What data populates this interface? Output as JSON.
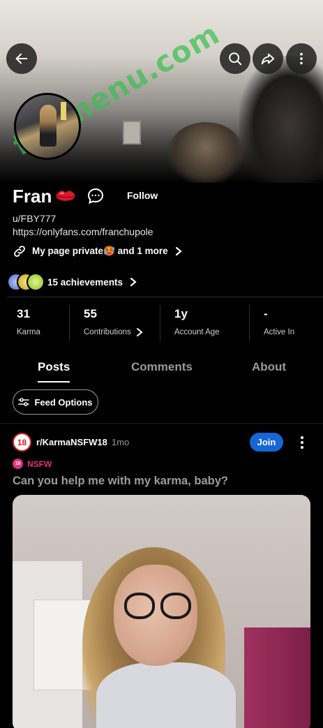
{
  "profile": {
    "display_name": "Fran",
    "username": "u/FBY777",
    "link": "https://onlyfans.com/franchupole",
    "follow_label": "Follow",
    "links_text": "My page private🥵 and 1 more",
    "achievements_text": "15 achievements"
  },
  "watermark": "fapmenu.com",
  "stats": [
    {
      "value": "31",
      "label": "Karma"
    },
    {
      "value": "55",
      "label": "Contributions"
    },
    {
      "value": "1y",
      "label": "Account Age"
    },
    {
      "value": "-",
      "label": "Active In"
    }
  ],
  "tabs": [
    {
      "label": "Posts",
      "active": true
    },
    {
      "label": "Comments",
      "active": false
    },
    {
      "label": "About",
      "active": false
    }
  ],
  "feed_options_label": "Feed Options",
  "post": {
    "subreddit": "r/KarmaNSFW18",
    "subreddit_badge": "18",
    "time": "1mo",
    "join_label": "Join",
    "nsfw_label": "NSFW",
    "nsfw_badge": "18",
    "title": "Can you help me with my karma, baby?"
  },
  "colors": {
    "background": "#000000",
    "join_button": "#1666d6",
    "nsfw": "#e0317b",
    "watermark": "#3cbe50"
  }
}
